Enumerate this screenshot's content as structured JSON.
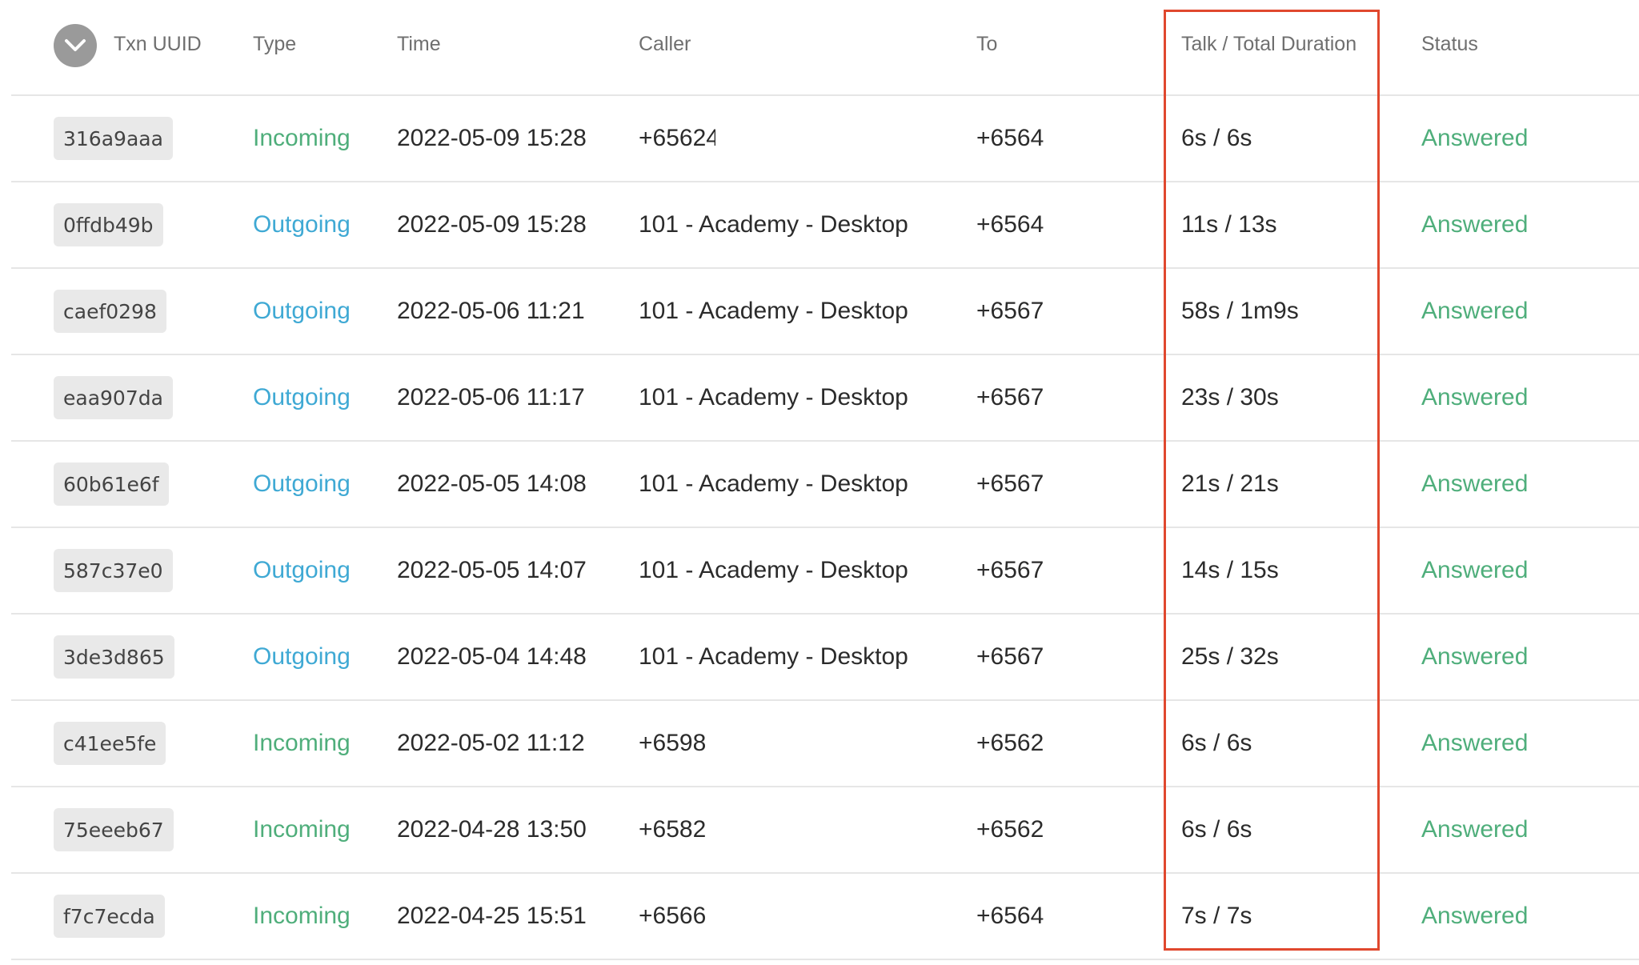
{
  "columns": {
    "txn_uuid": "Txn UUID",
    "type": "Type",
    "time": "Time",
    "caller": "Caller",
    "to": "To",
    "duration": "Talk / Total Duration",
    "status": "Status"
  },
  "colors": {
    "incoming": "#4fae7b",
    "outgoing": "#3fa9d4",
    "answered": "#4fae7b",
    "highlight_border": "#e0482e",
    "badge_bg": "#e9e9e9",
    "chevron_bg": "#9a9a9a"
  },
  "rows": [
    {
      "uuid": "316a9aaa",
      "type": "Incoming",
      "time": "2022-05-09 15:28",
      "caller": "+65624",
      "to": "+6564",
      "duration": "6s / 6s",
      "status": "Answered"
    },
    {
      "uuid": "0ffdb49b",
      "type": "Outgoing",
      "time": "2022-05-09 15:28",
      "caller": "101 - Academy  - Desktop",
      "to": "+6564",
      "duration": "11s / 13s",
      "status": "Answered"
    },
    {
      "uuid": "caef0298",
      "type": "Outgoing",
      "time": "2022-05-06 11:21",
      "caller": "101 - Academy  - Desktop",
      "to": "+6567",
      "duration": "58s / 1m9s",
      "status": "Answered"
    },
    {
      "uuid": "eaa907da",
      "type": "Outgoing",
      "time": "2022-05-06 11:17",
      "caller": "101 - Academy  - Desktop",
      "to": "+6567",
      "duration": "23s / 30s",
      "status": "Answered"
    },
    {
      "uuid": "60b61e6f",
      "type": "Outgoing",
      "time": "2022-05-05 14:08",
      "caller": "101 - Academy  - Desktop",
      "to": "+6567",
      "duration": "21s / 21s",
      "status": "Answered"
    },
    {
      "uuid": "587c37e0",
      "type": "Outgoing",
      "time": "2022-05-05 14:07",
      "caller": "101 - Academy  - Desktop",
      "to": "+6567",
      "duration": "14s / 15s",
      "status": "Answered"
    },
    {
      "uuid": "3de3d865",
      "type": "Outgoing",
      "time": "2022-05-04 14:48",
      "caller": "101 - Academy  - Desktop",
      "to": "+6567",
      "duration": "25s / 32s",
      "status": "Answered"
    },
    {
      "uuid": "c41ee5fe",
      "type": "Incoming",
      "time": "2022-05-02 11:12",
      "caller": "+6598",
      "to": "+6562",
      "duration": "6s / 6s",
      "status": "Answered"
    },
    {
      "uuid": "75eeeb67",
      "type": "Incoming",
      "time": "2022-04-28 13:50",
      "caller": "+6582",
      "to": "+6562",
      "duration": "6s / 6s",
      "status": "Answered"
    },
    {
      "uuid": "f7c7ecda",
      "type": "Incoming",
      "time": "2022-04-25 15:51",
      "caller": "+6566",
      "to": "+6564",
      "duration": "7s / 7s",
      "status": "Answered"
    }
  ]
}
